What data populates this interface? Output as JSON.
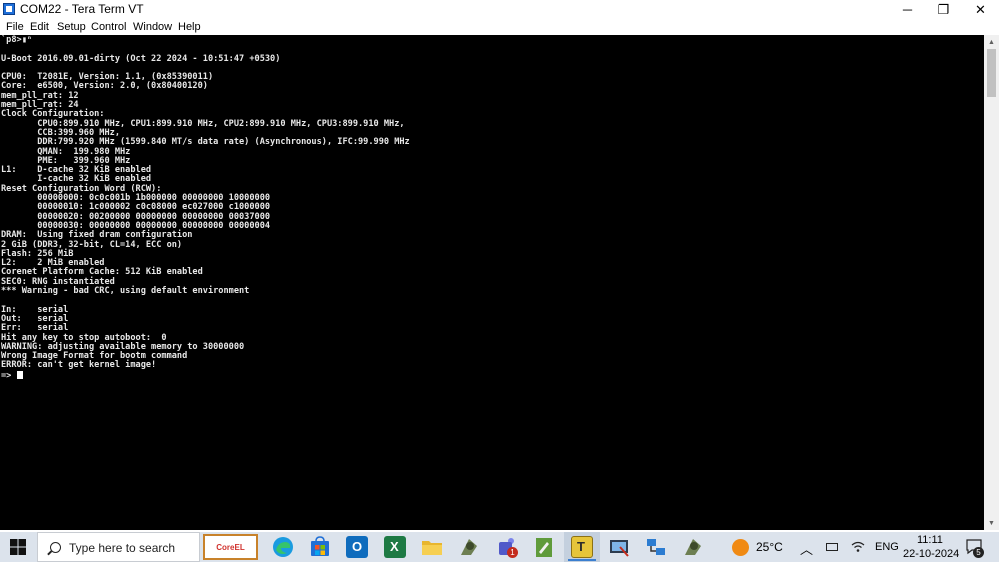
{
  "window": {
    "title": "COM22 - Tera Term VT",
    "minimize": "─",
    "maximize": "❐",
    "close": "✕"
  },
  "menu": [
    "File",
    "Edit",
    "Setup",
    "Control",
    "Window",
    "Help"
  ],
  "terminal": {
    "lines": [
      "`p8>▮ⁿ",
      "",
      "U-Boot 2016.09.01-dirty (Oct 22 2024 - 10:51:47 +0530)",
      "",
      "CPU0:  T2081E, Version: 1.1, (0x85390011)",
      "Core:  e6500, Version: 2.0, (0x80400120)",
      "mem_pll_rat: 12",
      "mem_pll_rat: 24",
      "Clock Configuration:",
      "       CPU0:899.910 MHz, CPU1:899.910 MHz, CPU2:899.910 MHz, CPU3:899.910 MHz,",
      "       CCB:399.960 MHz,",
      "       DDR:799.920 MHz (1599.840 MT/s data rate) (Asynchronous), IFC:99.990 MHz",
      "       QMAN:  199.980 MHz",
      "       PME:   399.960 MHz",
      "L1:    D-cache 32 KiB enabled",
      "       I-cache 32 KiB enabled",
      "Reset Configuration Word (RCW):",
      "       00000000: 0c0c001b 1b000000 00000000 10000000",
      "       00000010: 1c000002 c0c08000 ec027000 c1000000",
      "       00000020: 00200000 00000000 00000000 00037000",
      "       00000030: 00000000 00000000 00000000 00000004",
      "DRAM:  Using fixed dram configuration",
      "2 GiB (DDR3, 32-bit, CL=14, ECC on)",
      "Flash: 256 MiB",
      "L2:    2 MiB enabled",
      "Corenet Platform Cache: 512 KiB enabled",
      "SEC0: RNG instantiated",
      "*** Warning - bad CRC, using default environment",
      "",
      "In:    serial",
      "Out:   serial",
      "Err:   serial",
      "Hit any key to stop autoboot:  0",
      "WARNING: adjusting available memory to 30000000",
      "Wrong Image Format for bootm command",
      "ERROR: can't get kernel image!"
    ],
    "prompt": "=> "
  },
  "taskbar": {
    "search_placeholder": "Type here to search",
    "coreel_label": "CoreEL",
    "outlook_letter": "O",
    "excel_letter": "X",
    "teams_badge": "1",
    "teraterm_letter": "T",
    "weather_temp": "25°C",
    "language": "ENG",
    "time": "11:11",
    "date": "22-10-2024",
    "notification_count": "5"
  },
  "colors": {
    "terminal_bg": "#000000",
    "terminal_fg": "#e8e8e8",
    "taskbar_bg": "#dce3ec",
    "accent": "#3b7fd0"
  }
}
